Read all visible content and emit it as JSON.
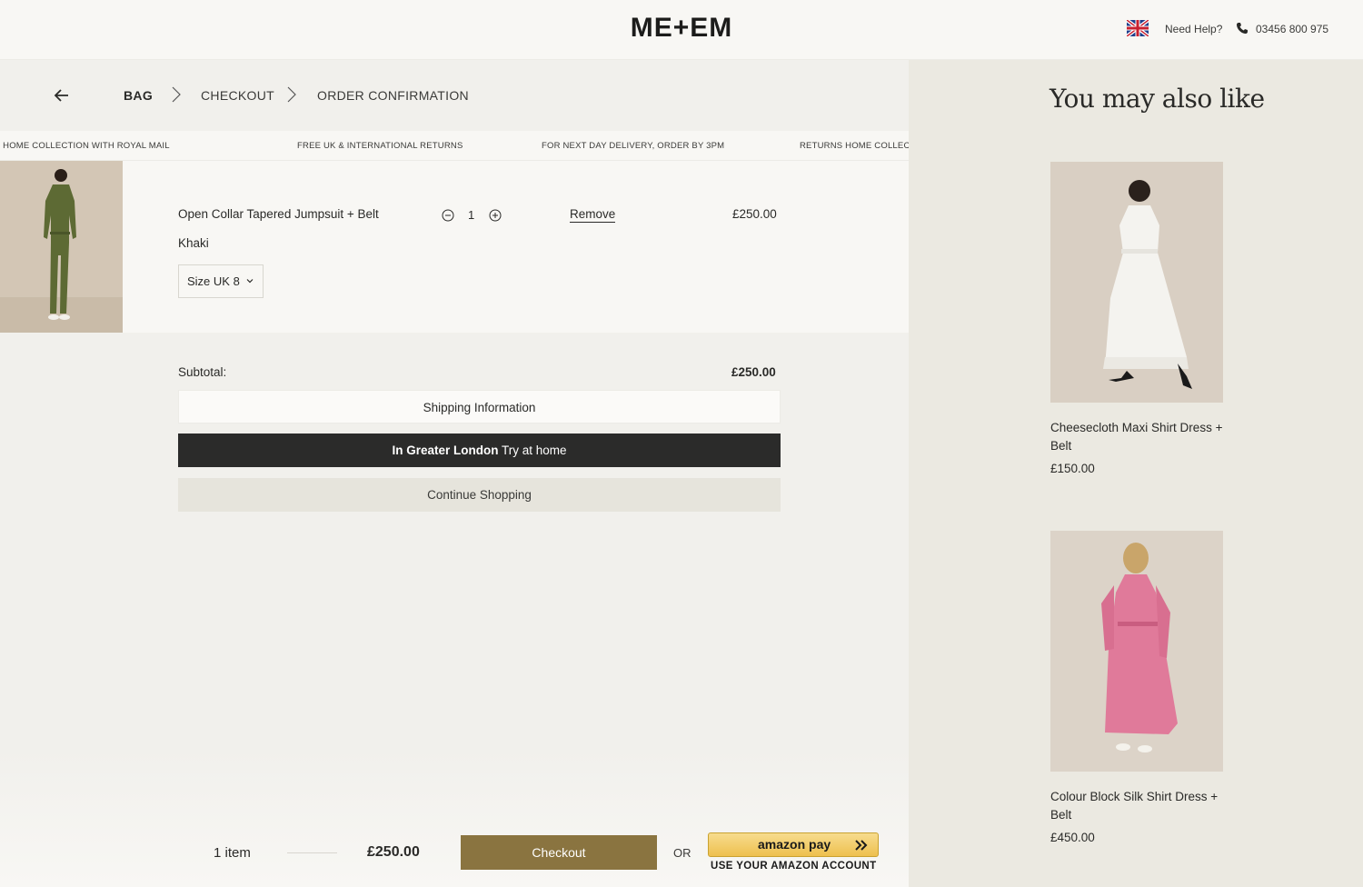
{
  "header": {
    "logo": "ME+EM",
    "help": "Need Help?",
    "phone": "03456 800 975"
  },
  "breadcrumb": {
    "steps": [
      "BAG",
      "CHECKOUT",
      "ORDER CONFIRMATION"
    ]
  },
  "ticker": [
    "RETURNS HOME COLLECTION WITH ROYAL MAIL",
    "FREE UK & INTERNATIONAL RETURNS",
    "FOR NEXT DAY DELIVERY, ORDER BY 3PM",
    "RETURNS HOME COLLECTION"
  ],
  "bag_item": {
    "name": "Open Collar Tapered Jumpsuit + Belt",
    "color": "Khaki",
    "size": "Size UK 8",
    "quantity": "1",
    "remove_label": "Remove",
    "price": "£250.00"
  },
  "summary": {
    "subtotal_label": "Subtotal:",
    "subtotal_value": "£250.00",
    "shipping_label": "Shipping Information",
    "london_bold": "In Greater London",
    "london_rest": "Try at home",
    "continue_label": "Continue Shopping"
  },
  "footer": {
    "items": "1 item",
    "total": "£250.00",
    "checkout_label": "Checkout",
    "or_label": "OR",
    "amazon_label": "amazon pay",
    "amazon_sub": "USE YOUR AMAZON ACCOUNT"
  },
  "sidebar": {
    "title": "You may also like",
    "products": [
      {
        "name": "Cheesecloth Maxi Shirt Dress + Belt",
        "price": "£150.00"
      },
      {
        "name": "Colour Block Silk Shirt Dress + Belt",
        "price": "£450.00"
      }
    ]
  },
  "colors": {
    "checkout": "#8a7440",
    "dark_button": "#2b2b2a",
    "sidebar_bg": "#ebe9e1"
  }
}
